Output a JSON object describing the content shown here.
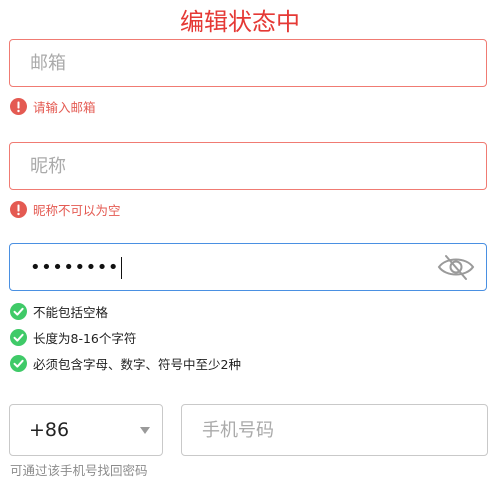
{
  "title": "编辑状态中",
  "email": {
    "placeholder": "邮箱",
    "value": "",
    "error": "请输入邮箱"
  },
  "nickname": {
    "placeholder": "昵称",
    "value": "",
    "error": "昵称不可以为空"
  },
  "password": {
    "masked_value": "••••••••",
    "toggle_icon": "eye-off-icon",
    "rules": [
      "不能包括空格",
      "长度为8-16个字符",
      "必须包含字母、数字、符号中至少2种"
    ]
  },
  "phone": {
    "country_code": "+86",
    "placeholder": "手机号码",
    "value": "",
    "hint": "可通过该手机号找回密码"
  },
  "colors": {
    "title": "#e53935",
    "error": "#e45a52",
    "success": "#3fca68",
    "focus_border": "#4a90e2",
    "error_border": "#f07b73"
  }
}
